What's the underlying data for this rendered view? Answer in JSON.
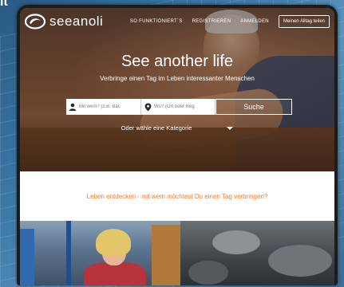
{
  "corner_text": "it",
  "brand": {
    "name": "seeanoli",
    "logo_icon": "seeanoli-logo-icon"
  },
  "nav": {
    "how_it_works": "SO FUNKTIONIERT´S",
    "register": "REGISTRIEREN",
    "login": "ANMELDEN",
    "share_cta": "Meinen Alltag teilen"
  },
  "hero": {
    "title": "See another life",
    "subtitle": "Verbringe einen Tag im Leben interessanter Menschen"
  },
  "search": {
    "who_placeholder": "Mit wem? (z.B. Bäc",
    "where_placeholder": "Wo? (Ort oder Reg",
    "who_icon": "person-icon",
    "where_icon": "location-pin-icon",
    "button_label": "Suche"
  },
  "category": {
    "label": "Oder wähle eine Kategorie",
    "icon": "chevron-down-icon"
  },
  "discover": {
    "text": "Leben entdecken - mit wem möchtest Du einen Tag verbringen?"
  },
  "colors": {
    "accent_orange": "#ee7b2a",
    "white": "#ffffff"
  }
}
